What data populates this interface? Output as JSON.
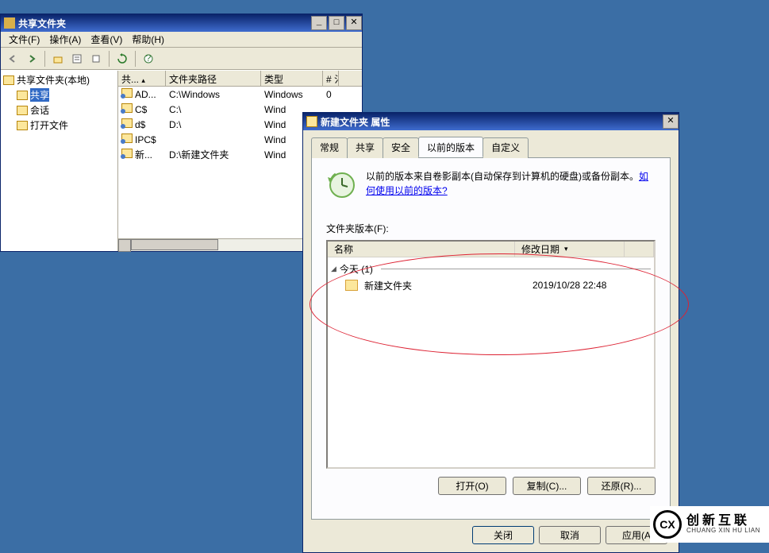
{
  "mmc": {
    "title": "共享文件夹",
    "menus": [
      "文件(F)",
      "操作(A)",
      "查看(V)",
      "帮助(H)"
    ],
    "tree": {
      "root": "共享文件夹(本地)",
      "items": [
        "共享",
        "会话",
        "打开文件"
      ]
    },
    "columns": {
      "name": "共...",
      "path": "文件夹路径",
      "type": "类型",
      "num": "# 氵"
    },
    "rows": [
      {
        "name": "AD...",
        "path": "C:\\Windows",
        "type": "Windows",
        "num": "0"
      },
      {
        "name": "C$",
        "path": "C:\\",
        "type": "Wind",
        "num": ""
      },
      {
        "name": "d$",
        "path": "D:\\",
        "type": "Wind",
        "num": ""
      },
      {
        "name": "IPC$",
        "path": "",
        "type": "Wind",
        "num": ""
      },
      {
        "name": "新...",
        "path": "D:\\新建文件夹",
        "type": "Wind",
        "num": ""
      }
    ],
    "winbtns": {
      "min": "_",
      "max": "□",
      "close": "✕"
    },
    "tree_chevron": "▸"
  },
  "props": {
    "title": "新建文件夹 属性",
    "close": "✕",
    "tabs": [
      "常规",
      "共享",
      "安全",
      "以前的版本",
      "自定义"
    ],
    "active_tab": 3,
    "info_line1": "以前的版本来自卷影副本(自动保存到计算机的硬盘)或备份副本。",
    "info_link": "如何使用以前的版本?",
    "versions_label": "文件夹版本(F):",
    "ver_cols": {
      "name": "名称",
      "date": "修改日期",
      "sort": "▾"
    },
    "group": {
      "chev": "◢",
      "label": "今天 (1)"
    },
    "item": {
      "name": "新建文件夹",
      "date": "2019/10/28 22:48"
    },
    "actions": {
      "open": "打开(O)",
      "copy": "复制(C)...",
      "restore": "还原(R)..."
    },
    "dlg": {
      "close": "关闭",
      "cancel": "取消",
      "apply": "应用(A"
    }
  },
  "watermark": {
    "logo": "CX",
    "cn": "创新互联",
    "py": "CHUANG XIN HU LIAN"
  }
}
